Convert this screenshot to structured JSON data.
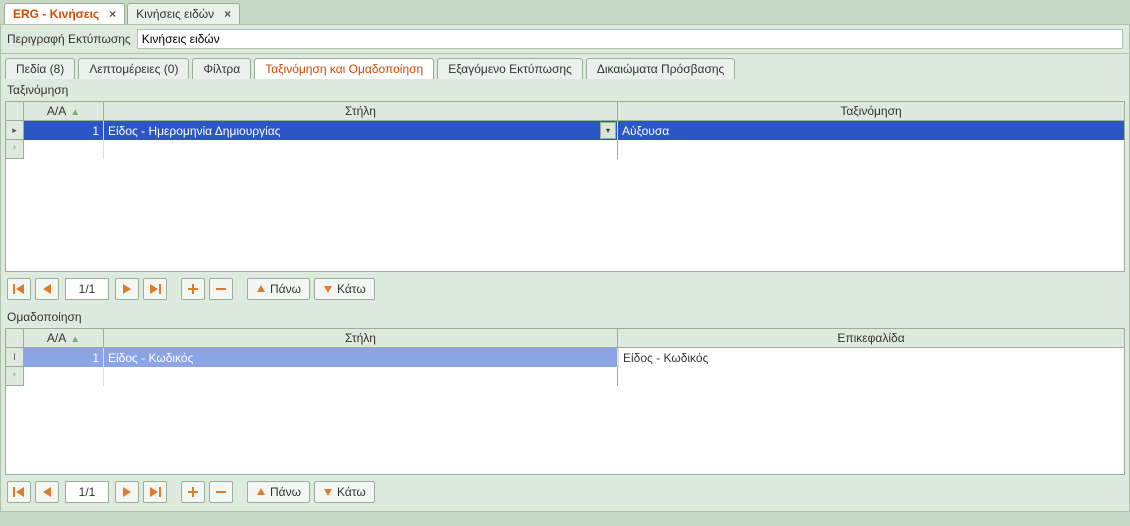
{
  "topTabs": [
    {
      "label": "ERG - Κινήσεις",
      "active": true
    },
    {
      "label": "Κινήσεις ειδών",
      "active": false
    }
  ],
  "descLabel": "Περιγραφή Εκτύπωσης",
  "descValue": "Κινήσεις ειδών",
  "innerTabs": [
    {
      "label": "Πεδία (8)"
    },
    {
      "label": "Λεπτομέρειες (0)"
    },
    {
      "label": "Φίλτρα"
    },
    {
      "label": "Ταξινόμηση και Ομαδοποίηση",
      "active": true
    },
    {
      "label": "Εξαγόμενο Εκτύπωσης"
    },
    {
      "label": "Δικαιώματα Πρόσβασης"
    }
  ],
  "sort": {
    "title": "Ταξινόμηση",
    "headers": {
      "aa": "Α/Α",
      "stili": "Στήλη",
      "taxi": "Ταξινόμηση"
    },
    "rows": [
      {
        "aa": "1",
        "stili": "Είδος - Ημερομηνία Δημιουργίας",
        "taxi": "Αύξουσα"
      }
    ],
    "page": "1/1"
  },
  "group": {
    "title": "Ομαδοποίηση",
    "headers": {
      "aa": "Α/Α",
      "stili": "Στήλη",
      "epikef": "Επικεφαλίδα"
    },
    "rows": [
      {
        "aa": "1",
        "stili": "Είδος - Κωδικός",
        "epikef": "Είδος - Κωδικός"
      }
    ],
    "page": "1/1"
  },
  "buttons": {
    "up": "Πάνω",
    "down": "Κάτω"
  }
}
